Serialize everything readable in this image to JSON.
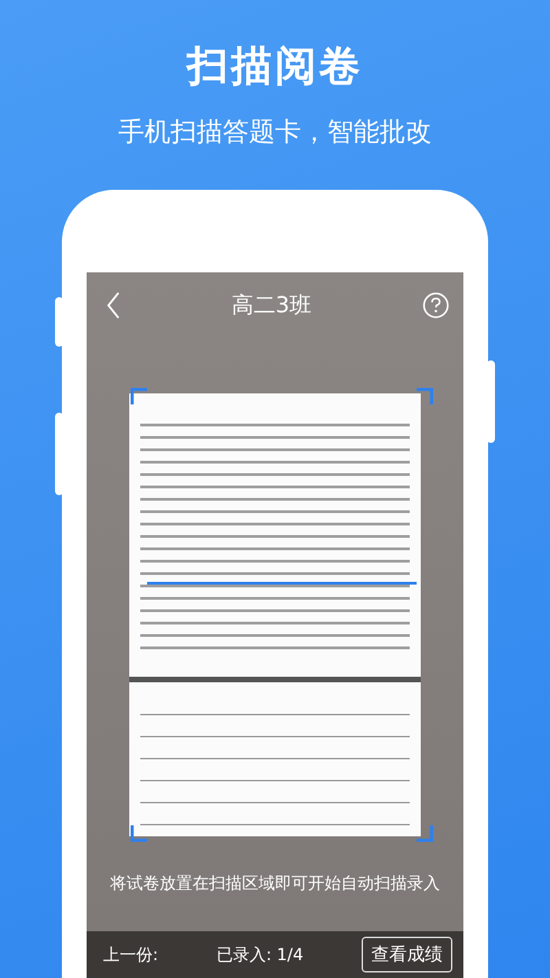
{
  "banner": {
    "title": "扫描阅卷",
    "subtitle": "手机扫描答题卡，智能批改"
  },
  "header": {
    "title": "高二3班"
  },
  "scanner": {
    "hint": "将试卷放置在扫描区域即可开始自动扫描录入"
  },
  "bottom_bar": {
    "previous": "上一份:",
    "progress": "已录入: 1/4",
    "button": "查看成绩"
  }
}
